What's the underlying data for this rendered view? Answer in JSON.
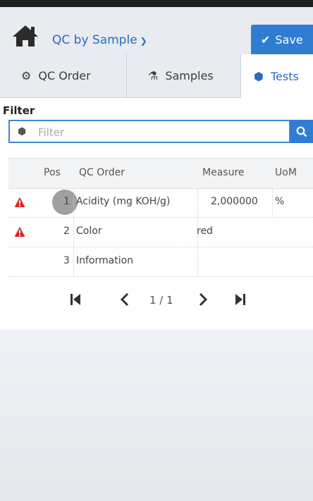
{
  "header": {
    "title": "QC by Sample",
    "save_label": "Save",
    "colors": {
      "accent": "#2f7cd3",
      "link": "#2a6bc4",
      "warning": "#e02424"
    }
  },
  "tabs": [
    {
      "label": "QC Order",
      "icon": "cogs-icon"
    },
    {
      "label": "Samples",
      "icon": "flask-icon"
    },
    {
      "label": "Tests",
      "icon": "cube-icon",
      "active": true
    }
  ],
  "filter": {
    "label": "Filter",
    "placeholder": "Filter",
    "value": ""
  },
  "grid": {
    "columns": [
      "Pos",
      "QC Order",
      "Measure",
      "UoM"
    ],
    "rows": [
      {
        "warning": true,
        "pos": "1",
        "qc_order": "Acidity (mg KOH/g)",
        "measure": "2,000000",
        "uom": "%"
      },
      {
        "warning": true,
        "pos": "2",
        "qc_order": "Color",
        "measure": "red",
        "uom": ""
      },
      {
        "warning": false,
        "pos": "3",
        "qc_order": "Information",
        "measure": "",
        "uom": ""
      }
    ]
  },
  "pager": {
    "indicator": "1 / 1"
  }
}
